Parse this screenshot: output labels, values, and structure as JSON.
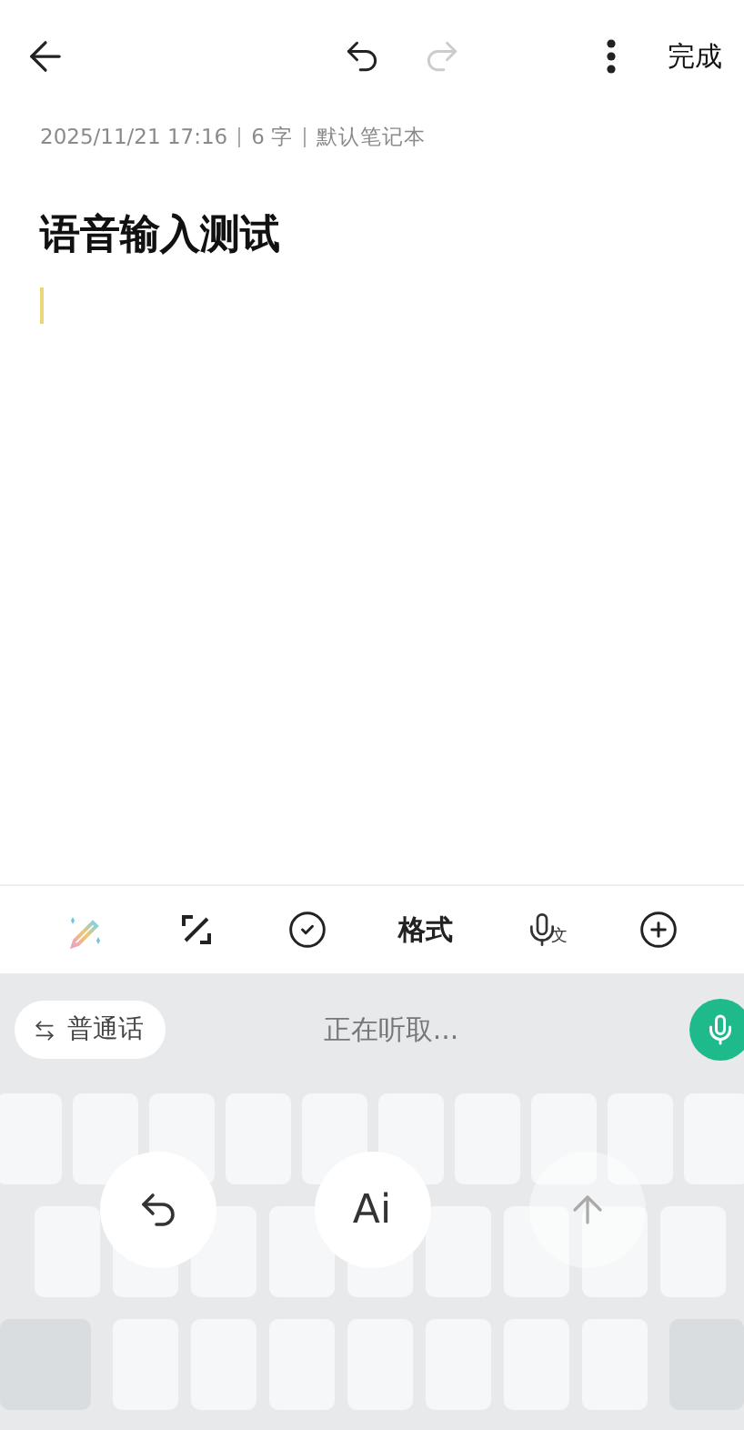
{
  "top_bar": {
    "undo_disabled": false,
    "redo_disabled": true,
    "done": "完成"
  },
  "meta": {
    "date": "2025/11/21 17:16",
    "count": "6 字",
    "notebook": "默认笔记本"
  },
  "note": {
    "title": "语音输入测试",
    "cursor": true
  },
  "format_toolbar": [
    {
      "kind": "pen"
    },
    {
      "kind": "slash"
    },
    {
      "kind": "check"
    },
    {
      "kind": "text",
      "label": "格式"
    },
    {
      "kind": "voice-text",
      "label": "文"
    },
    {
      "kind": "add"
    }
  ],
  "voice_panel": {
    "language": "普通话",
    "status": "正在听取...",
    "listening": true
  },
  "voice_actions": [
    {
      "kind": "return",
      "disabled": false
    },
    {
      "kind": "ai",
      "label": "Ai",
      "disabled": false
    },
    {
      "kind": "send",
      "disabled": true
    }
  ]
}
